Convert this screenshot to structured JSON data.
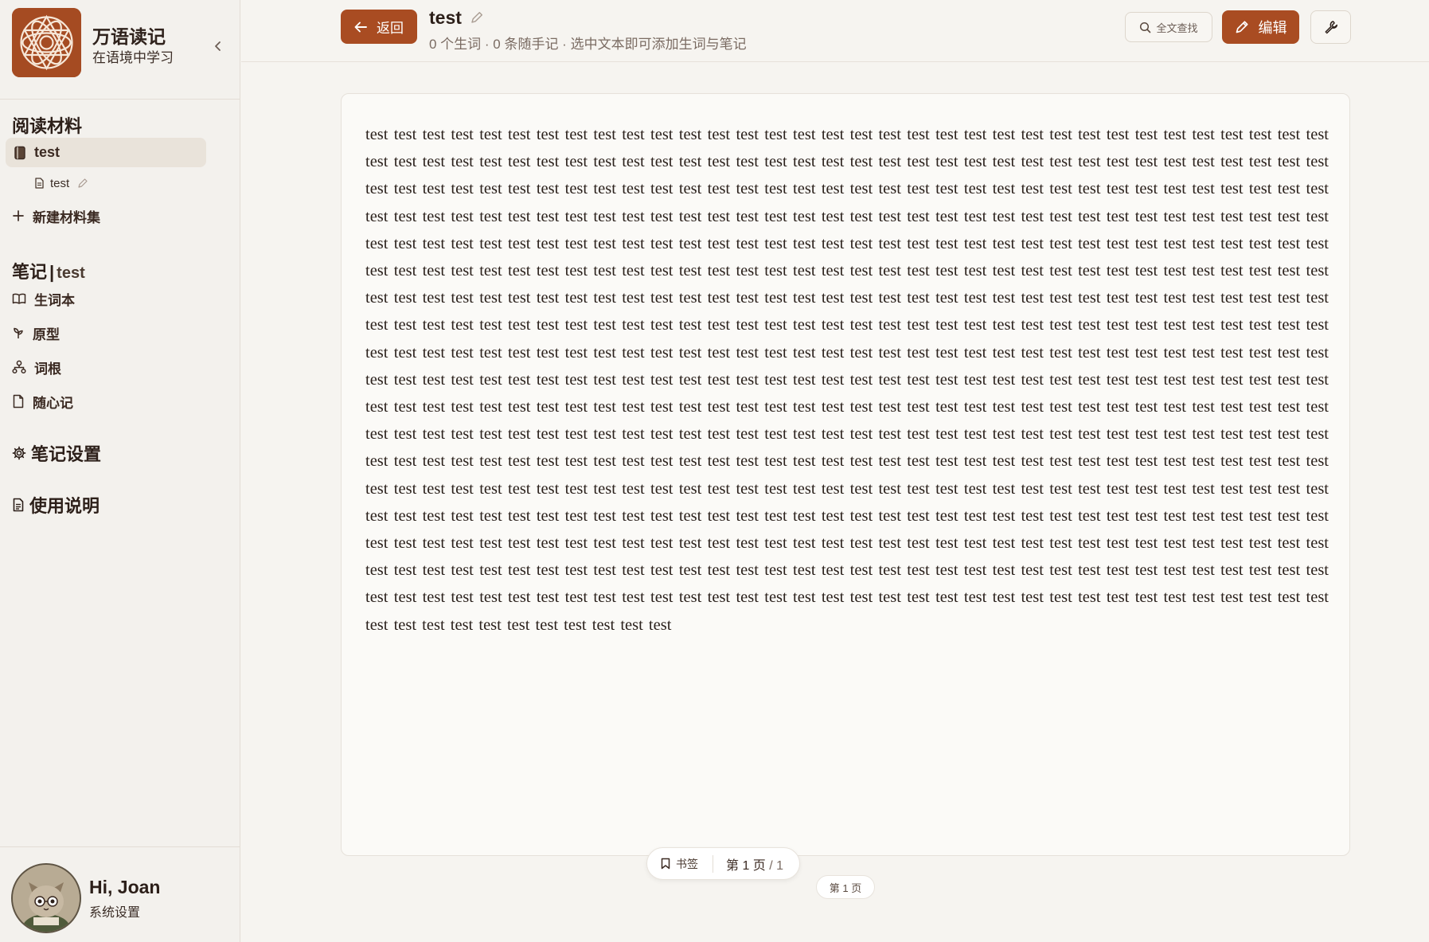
{
  "brand": {
    "title": "万语读记",
    "subtitle": "在语境中学习"
  },
  "sidebar": {
    "reading_section": "阅读材料",
    "collection": {
      "label": "test"
    },
    "document": {
      "label": "test"
    },
    "new_collection": "新建材料集",
    "notes_section": {
      "title": "笔记",
      "separator": "|",
      "sub": "test"
    },
    "notes_items": [
      {
        "label": "生词本",
        "icon": "book-open-icon"
      },
      {
        "label": "原型",
        "icon": "sprout-icon"
      },
      {
        "label": "词根",
        "icon": "network-icon"
      },
      {
        "label": "随心记",
        "icon": "file-icon"
      }
    ],
    "note_settings": "笔记设置",
    "usage_guide": "使用说明"
  },
  "user": {
    "greeting": "Hi, Joan",
    "settings_link": "系统设置"
  },
  "header": {
    "back_label": "返回",
    "title": "test",
    "meta": "0 个生词 · 0 条随手记 · 选中文本即可添加生词与笔记",
    "search_label": "全文查找",
    "edit_label": "编辑"
  },
  "reader": {
    "word": "test",
    "word_count": 623
  },
  "pager": {
    "bookmark_label": "书签",
    "current_page": "第 1 页",
    "separator": "/",
    "total_pages": "1",
    "page_tag": "第 1 页"
  },
  "colors": {
    "accent": "#a94c22",
    "sidebar_bg": "#f3f1ed",
    "page_bg": "#f6f4f0",
    "reader_bg": "#fbfaf7"
  }
}
